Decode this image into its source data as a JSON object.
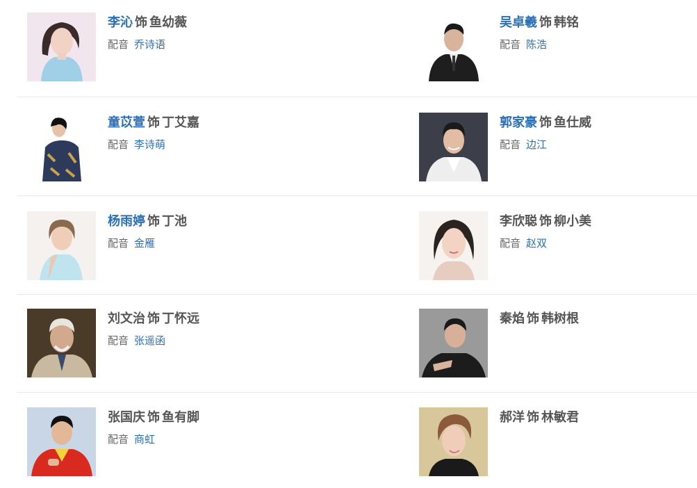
{
  "cast": [
    {
      "actor": "李沁",
      "actor_linked": true,
      "plays": "饰",
      "role": "鱼幼薇",
      "voice_label": "配音",
      "voice_actor": "乔诗语"
    },
    {
      "actor": "吴卓羲",
      "actor_linked": true,
      "plays": "饰",
      "role": "韩铭",
      "voice_label": "配音",
      "voice_actor": "陈浩"
    },
    {
      "actor": "童苡萱",
      "actor_linked": true,
      "plays": "饰",
      "role": "丁艾嘉",
      "voice_label": "配音",
      "voice_actor": "李诗萌"
    },
    {
      "actor": "郭家豪",
      "actor_linked": true,
      "plays": "饰",
      "role": "鱼仕威",
      "voice_label": "配音",
      "voice_actor": "边江"
    },
    {
      "actor": "杨雨婷",
      "actor_linked": true,
      "plays": "饰",
      "role": "丁池",
      "voice_label": "配音",
      "voice_actor": "金雁"
    },
    {
      "actor": "李欣聪",
      "actor_linked": false,
      "plays": "饰",
      "role": "柳小美",
      "voice_label": "配音",
      "voice_actor": "赵双"
    },
    {
      "actor": "刘文治",
      "actor_linked": false,
      "plays": "饰",
      "role": "丁怀远",
      "voice_label": "配音",
      "voice_actor": "张遥函"
    },
    {
      "actor": "秦焰",
      "actor_linked": false,
      "plays": "饰",
      "role": "韩树根"
    },
    {
      "actor": "张国庆",
      "actor_linked": false,
      "plays": "饰",
      "role": "鱼有脚",
      "voice_label": "配音",
      "voice_actor": "商虹"
    },
    {
      "actor": "郝洋",
      "actor_linked": false,
      "plays": "饰",
      "role": "林敏君"
    }
  ],
  "colors": {
    "link": "#2b6fb6",
    "text": "#555555",
    "divider": "#e8e8e8"
  }
}
